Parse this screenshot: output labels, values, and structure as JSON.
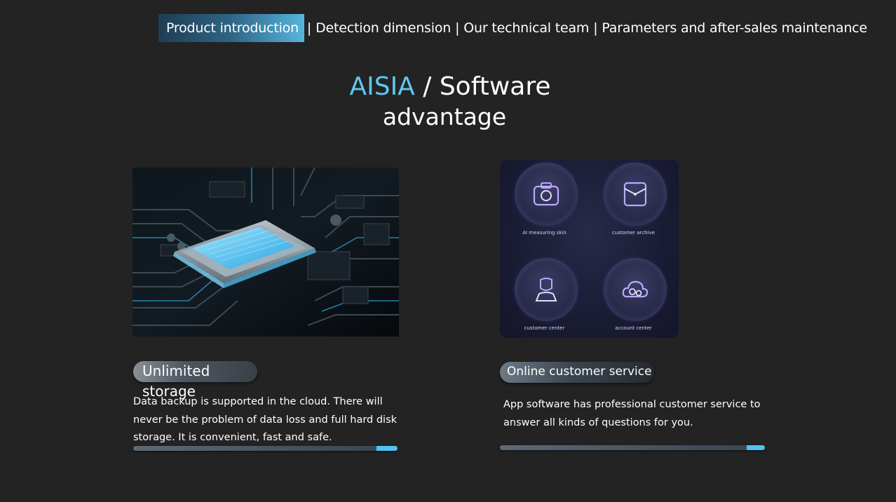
{
  "nav": {
    "items": [
      {
        "label": "Product introduction",
        "active": true
      },
      {
        "label": "Detection dimension",
        "active": false
      },
      {
        "label": "Our technical team",
        "active": false
      },
      {
        "label": "Parameters and after-sales maintenance",
        "active": false
      }
    ],
    "separator": "|"
  },
  "heading": {
    "brand": "AISIA",
    "slash": " / ",
    "title_part1": "Software",
    "title_part2": "advantage"
  },
  "features": [
    {
      "title": "Unlimited storage",
      "description": "Data backup is supported in the cloud. There will never be the problem of data loss and full hard disk storage. It is convenient, fast and safe.",
      "progress": 0.92
    },
    {
      "title": "Online customer service",
      "description": "App software has professional customer service to answer all kinds of questions for you.",
      "progress": 0.93
    }
  ],
  "app_screen": {
    "items": [
      {
        "label": "AI measuring skin",
        "icon": "camera-icon"
      },
      {
        "label": "customer archive",
        "icon": "folder-icon"
      },
      {
        "label": "customer center",
        "icon": "user-icon"
      },
      {
        "label": "account center",
        "icon": "cloud-gear-icon"
      }
    ]
  },
  "colors": {
    "background": "#232323",
    "accent": "#5ec8f2",
    "bar_fill": "#4fc3f7"
  }
}
